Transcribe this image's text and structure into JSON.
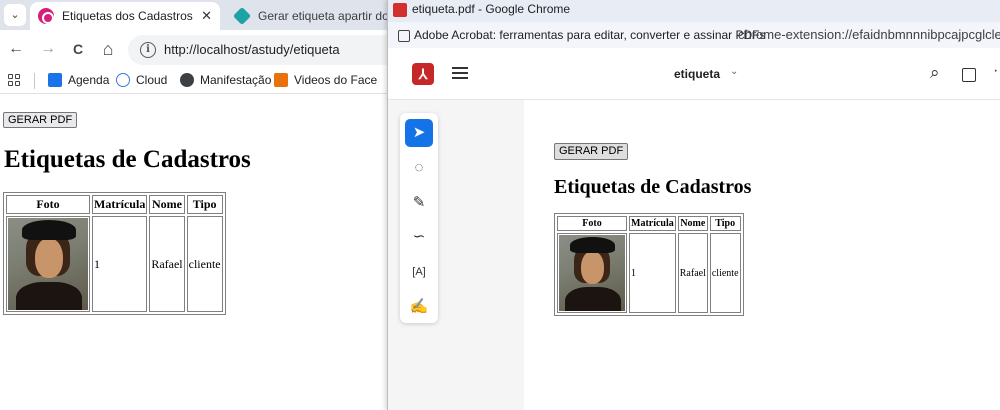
{
  "left_window": {
    "tabs": [
      {
        "title": "Etiquetas dos Cadastros",
        "close": "✕"
      },
      {
        "title": "Gerar etiqueta apartir do ba"
      }
    ],
    "tab_menu_icon": "chevron-down-icon",
    "nav": {
      "back": "←",
      "forward": "→",
      "reload": "C",
      "home": "⌂"
    },
    "url": "http://localhost/astudy/etiqueta",
    "bookmarks": [
      {
        "label": "Agenda",
        "icon": "agenda-icon",
        "color": "#1a73e8"
      },
      {
        "label": "Cloud",
        "icon": "cloud-icon",
        "color": "#3c78d8"
      },
      {
        "label": "Manifestação",
        "icon": "globe-icon",
        "color": "#3c4043"
      },
      {
        "label": "Videos do Face",
        "icon": "facebook-icon",
        "color": "#1877f2"
      }
    ]
  },
  "page": {
    "button_label": "GERAR PDF",
    "heading": "Etiquetas de Cadastros",
    "table": {
      "headers": [
        "Foto",
        "Matrícula",
        "Nome",
        "Tipo"
      ],
      "rows": [
        {
          "matricula": "1",
          "nome": "Rafael",
          "tipo": "cliente"
        }
      ]
    }
  },
  "right_window": {
    "title": "etiqueta.pdf - Google Chrome",
    "extension_name": "Adobe Acrobat: ferramentas para editar, converter e assinar PDFs",
    "extension_url": "chrome-extension://efaidnbmnnnibpcajpcglclefi",
    "doc_name": "etiqueta",
    "tools": [
      "select-icon",
      "comment-icon",
      "draw-icon",
      "lasso-icon",
      "text-box-icon",
      "sign-icon"
    ]
  },
  "colors": {
    "acrobat_red": "#c62828",
    "tool_selected": "#1473e6",
    "tab_bar": "#dfe3eb"
  }
}
